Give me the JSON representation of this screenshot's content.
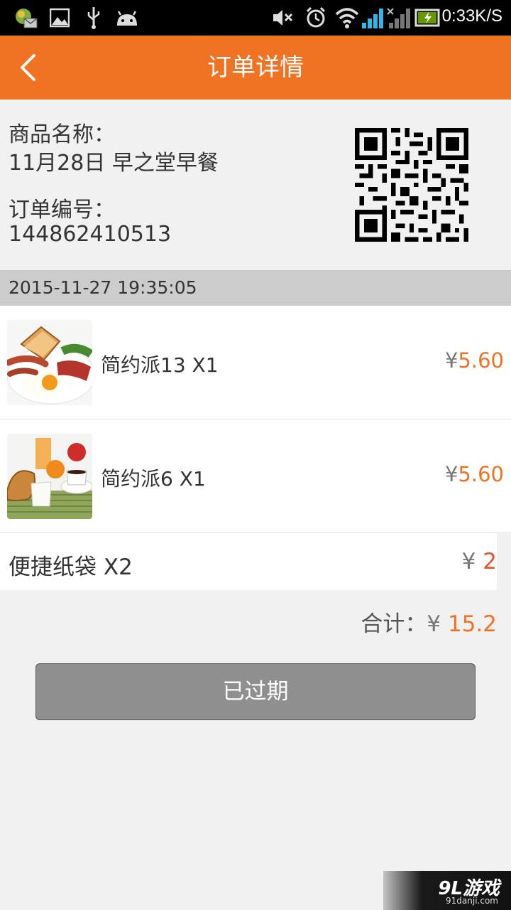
{
  "status_bar": {
    "speed": "0:33K/S",
    "icons": [
      "photo-app-icon",
      "image-icon",
      "usb-icon",
      "android-icon",
      "mute-icon",
      "alarm-icon",
      "wifi-icon",
      "signal-icon",
      "signal-no-service-icon",
      "battery-charging-icon"
    ]
  },
  "header": {
    "title": "订单详情",
    "back_icon": "chevron-left-icon"
  },
  "product": {
    "name_label": "商品名称：",
    "name_value": "11月28日 早之堂早餐",
    "order_label": "订单编号：",
    "order_value": "144862410513",
    "qr_icon": "qr-code"
  },
  "order_time": "2015-11-27 19:35:05",
  "items": [
    {
      "name": "简约派13 X1",
      "currency": "¥",
      "price": "5.60",
      "thumb": "breakfast-toast-eggs-photo"
    },
    {
      "name": "简约派6 X1",
      "currency": "¥",
      "price": "5.60",
      "thumb": "breakfast-coffee-croissant-photo"
    }
  ],
  "bag": {
    "name": "便捷纸袋 X2",
    "currency": "¥",
    "price": "2"
  },
  "total": {
    "label": "合计：",
    "currency": "¥",
    "value": "15.2"
  },
  "action_button": "已过期",
  "watermark": {
    "logo": "9L游戏",
    "site": "91danji.com"
  },
  "colors": {
    "accent": "#ef7322",
    "button_disabled": "#8f8f8f",
    "date_bar": "#cccccc"
  }
}
